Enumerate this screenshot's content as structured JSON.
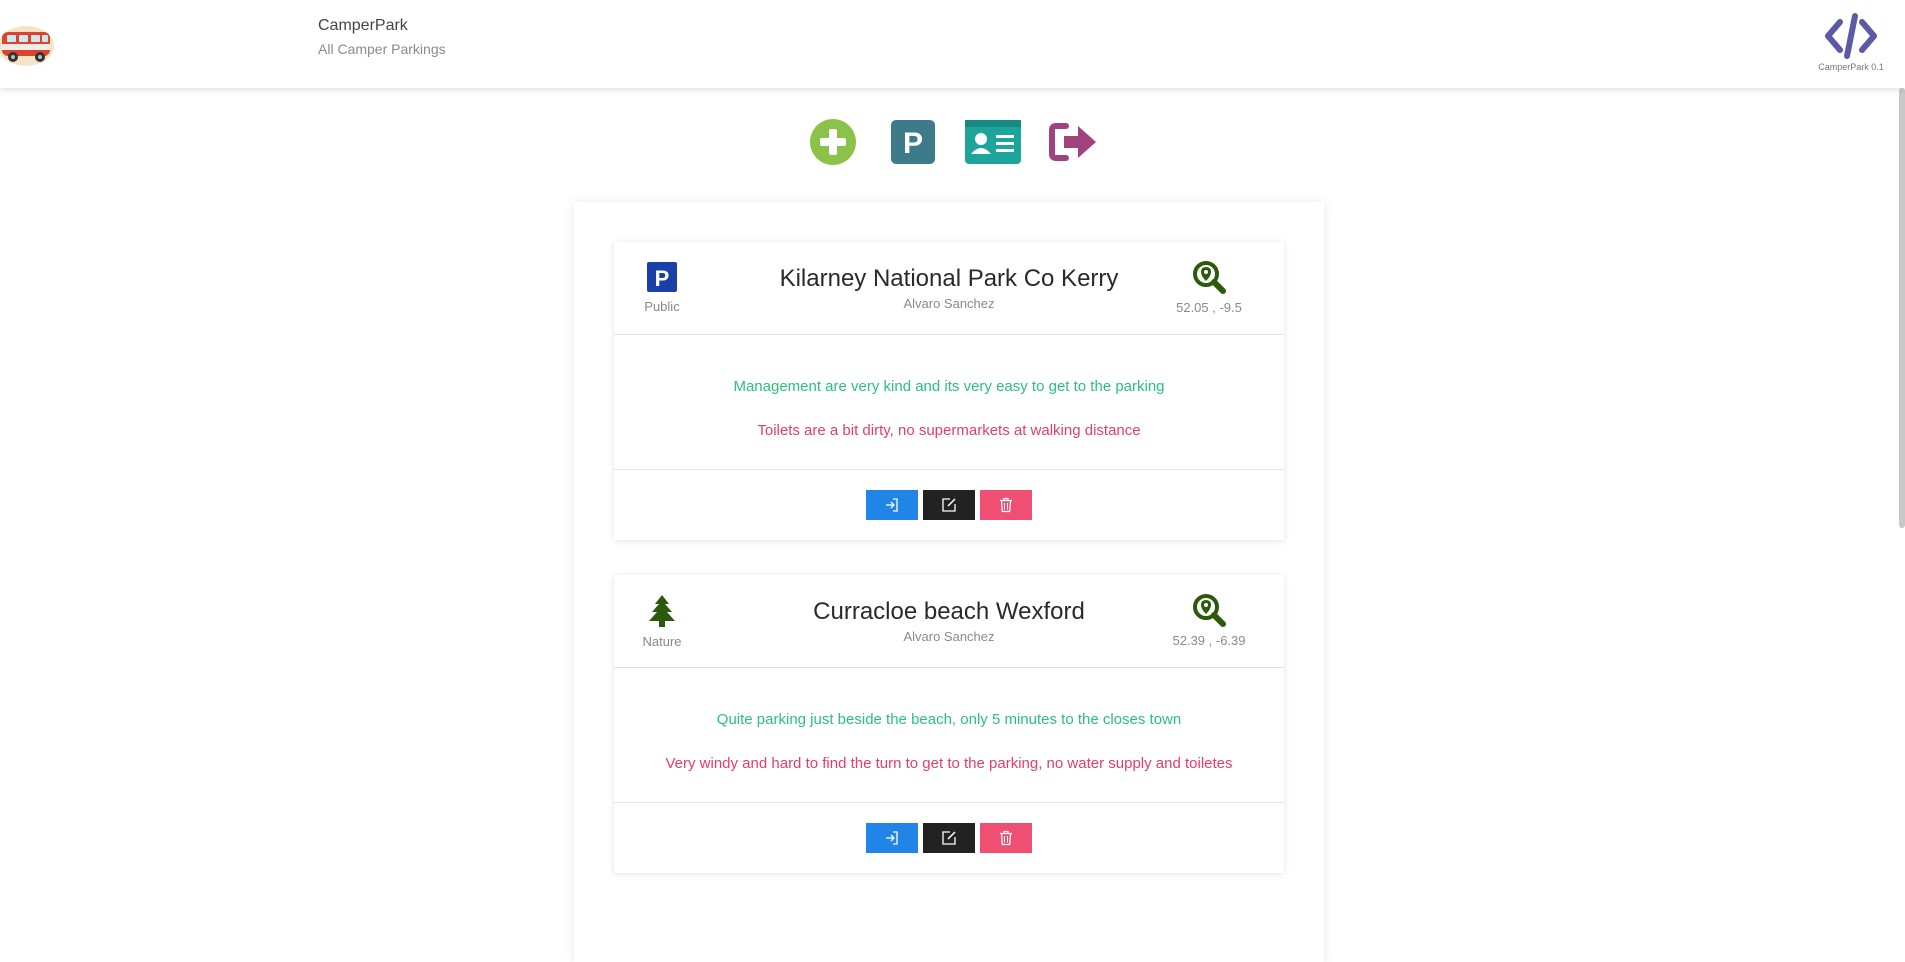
{
  "header": {
    "title": "CamperPark",
    "subtitle": "All Camper Parkings",
    "version": "CamperPark 0.1"
  },
  "actions": [
    {
      "icon": "plus-circle-icon",
      "color": "#8bc34a"
    },
    {
      "icon": "parking-icon",
      "color": "#3d7a8a"
    },
    {
      "icon": "id-card-icon",
      "color": "#1ea59b"
    },
    {
      "icon": "sign-out-icon",
      "color": "#a0427e"
    }
  ],
  "parkings": [
    {
      "name": "Kilarney National Park Co Kerry",
      "author": "Alvaro Sanchez",
      "type": "Public",
      "type_icon": "parking-icon",
      "coords": "52.05 , -9.5",
      "pros": "Management are very kind and its very easy to get to the parking",
      "cons": "Toilets are a bit dirty, no supermarkets at walking distance"
    },
    {
      "name": "Curracloe beach Wexford",
      "author": "Alvaro Sanchez",
      "type": "Nature",
      "type_icon": "tree-icon",
      "coords": "52.39 , -6.39",
      "pros": "Quite parking just beside the beach, only 5 minutes to the closes town",
      "cons": "Very windy and hard to find the turn to get to the parking, no water supply and toiletes"
    }
  ],
  "colors": {
    "pro": "#2cc07e",
    "con": "#e63d67",
    "enter": "#2185e8",
    "edit": "#222222",
    "delete": "#ef4f72",
    "map_icon": "#2b5a0c",
    "public_icon": "#1a3fa8",
    "nature_icon": "#2b5a0c"
  }
}
